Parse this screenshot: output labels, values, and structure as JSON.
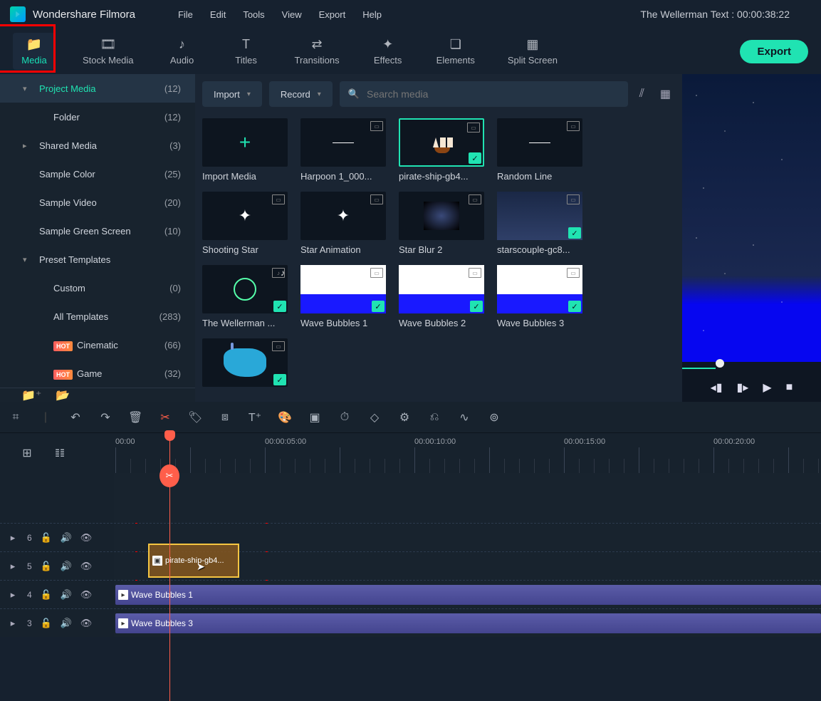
{
  "app_name": "Wondershare Filmora",
  "menu": [
    "File",
    "Edit",
    "Tools",
    "View",
    "Export",
    "Help"
  ],
  "project_title": "The Wellerman Text : 00:00:38:22",
  "tabs": [
    {
      "id": "media",
      "label": "Media"
    },
    {
      "id": "stock",
      "label": "Stock Media"
    },
    {
      "id": "audio",
      "label": "Audio"
    },
    {
      "id": "titles",
      "label": "Titles"
    },
    {
      "id": "transitions",
      "label": "Transitions"
    },
    {
      "id": "effects",
      "label": "Effects"
    },
    {
      "id": "elements",
      "label": "Elements"
    },
    {
      "id": "split",
      "label": "Split Screen"
    }
  ],
  "export_label": "Export",
  "sidebar": {
    "items": [
      {
        "label": "Project Media",
        "count": "(12)",
        "sel": true,
        "lvl": 1,
        "chev": "▾"
      },
      {
        "label": "Folder",
        "count": "(12)",
        "lvl": 2
      },
      {
        "label": "Shared Media",
        "count": "(3)",
        "lvl": 1,
        "chev": "▸"
      },
      {
        "label": "Sample Color",
        "count": "(25)",
        "lvl": 1
      },
      {
        "label": "Sample Video",
        "count": "(20)",
        "lvl": 1
      },
      {
        "label": "Sample Green Screen",
        "count": "(10)",
        "lvl": 1
      },
      {
        "label": "Preset Templates",
        "count": "",
        "lvl": 1,
        "chev": "▾"
      },
      {
        "label": "Custom",
        "count": "(0)",
        "lvl": 2
      },
      {
        "label": "All Templates",
        "count": "(283)",
        "lvl": 2
      },
      {
        "label": "Cinematic",
        "count": "(66)",
        "lvl": 2,
        "hot": true
      },
      {
        "label": "Game",
        "count": "(32)",
        "lvl": 2,
        "hot": true
      }
    ]
  },
  "panel": {
    "import_label": "Import",
    "record_label": "Record",
    "search_placeholder": "Search media",
    "cells": [
      {
        "label": "Import Media",
        "kind": "import"
      },
      {
        "label": "Harpoon 1_000...",
        "kind": "video",
        "draw": "dash"
      },
      {
        "label": "pirate-ship-gb4...",
        "kind": "image",
        "draw": "ship",
        "selected": true,
        "check": true
      },
      {
        "label": "Random Line",
        "kind": "video",
        "draw": "dash"
      },
      {
        "label": "Shooting Star",
        "kind": "video",
        "draw": "dot"
      },
      {
        "label": "Star Animation",
        "kind": "video",
        "draw": "dot"
      },
      {
        "label": "Star Blur 2",
        "kind": "video",
        "draw": "blur"
      },
      {
        "label": "starscouple-gc8...",
        "kind": "image",
        "draw": "sky",
        "check": true
      },
      {
        "label": "The Wellerman ...",
        "kind": "audio",
        "draw": "circle",
        "check": true
      },
      {
        "label": "Wave Bubbles 1",
        "kind": "video",
        "draw": "wave",
        "check": true
      },
      {
        "label": "Wave Bubbles 2",
        "kind": "video",
        "draw": "wave",
        "check": true
      },
      {
        "label": "Wave Bubbles 3",
        "kind": "video",
        "draw": "wave",
        "check": true
      },
      {
        "label": "",
        "kind": "image",
        "draw": "whale",
        "check": true
      }
    ]
  },
  "ruler": {
    "labels": [
      "00:00",
      "00:00:05:00",
      "00:00:10:00",
      "00:00:15:00",
      "00:00:20:00"
    ]
  },
  "tracks": [
    {
      "num": "6"
    },
    {
      "num": "5",
      "drag": {
        "label": "pirate-ship-gb4..."
      }
    },
    {
      "num": "4",
      "clip": {
        "label": "Wave Bubbles 1"
      }
    },
    {
      "num": "3",
      "clip": {
        "label": "Wave Bubbles 3"
      }
    }
  ],
  "hot_label": "HOT"
}
